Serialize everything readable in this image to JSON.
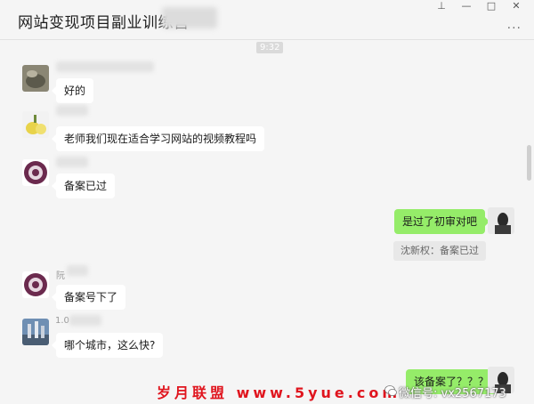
{
  "window": {
    "title": "网站变现项目副业训练营",
    "controls": {
      "pin": "⊥",
      "minimize": "—",
      "maximize": "□",
      "close": "✕"
    },
    "more": "···"
  },
  "chat": {
    "timestamp": "9:32",
    "messages": [
      {
        "side": "in",
        "name_prefix": "",
        "text": "好的"
      },
      {
        "side": "in",
        "name_prefix": "",
        "text": "老师我们现在适合学习网站的视频教程吗"
      },
      {
        "side": "in",
        "name_prefix": "",
        "text": "备案已过"
      },
      {
        "side": "out",
        "text": "是过了初审对吧",
        "quote": "沈新权：备案已过"
      },
      {
        "side": "in",
        "name_prefix": "阮",
        "text": "备案号下了"
      },
      {
        "side": "in",
        "name_prefix": "1.0",
        "text": "哪个城市，这么快?"
      },
      {
        "side": "out",
        "text": "该备案了？？？"
      }
    ]
  },
  "watermarks": {
    "site": "岁月联盟 www.5yue.com",
    "wechat": "微信号: vx2567173"
  },
  "colors": {
    "outgoing_bubble": "#95ec69",
    "incoming_bubble": "#ffffff",
    "watermark_red": "#e0151e"
  },
  "icons": {
    "pin": "pin-icon",
    "minimize": "minimize-icon",
    "maximize": "maximize-icon",
    "close": "close-icon",
    "more": "more-icon",
    "wechat": "wechat-icon"
  }
}
